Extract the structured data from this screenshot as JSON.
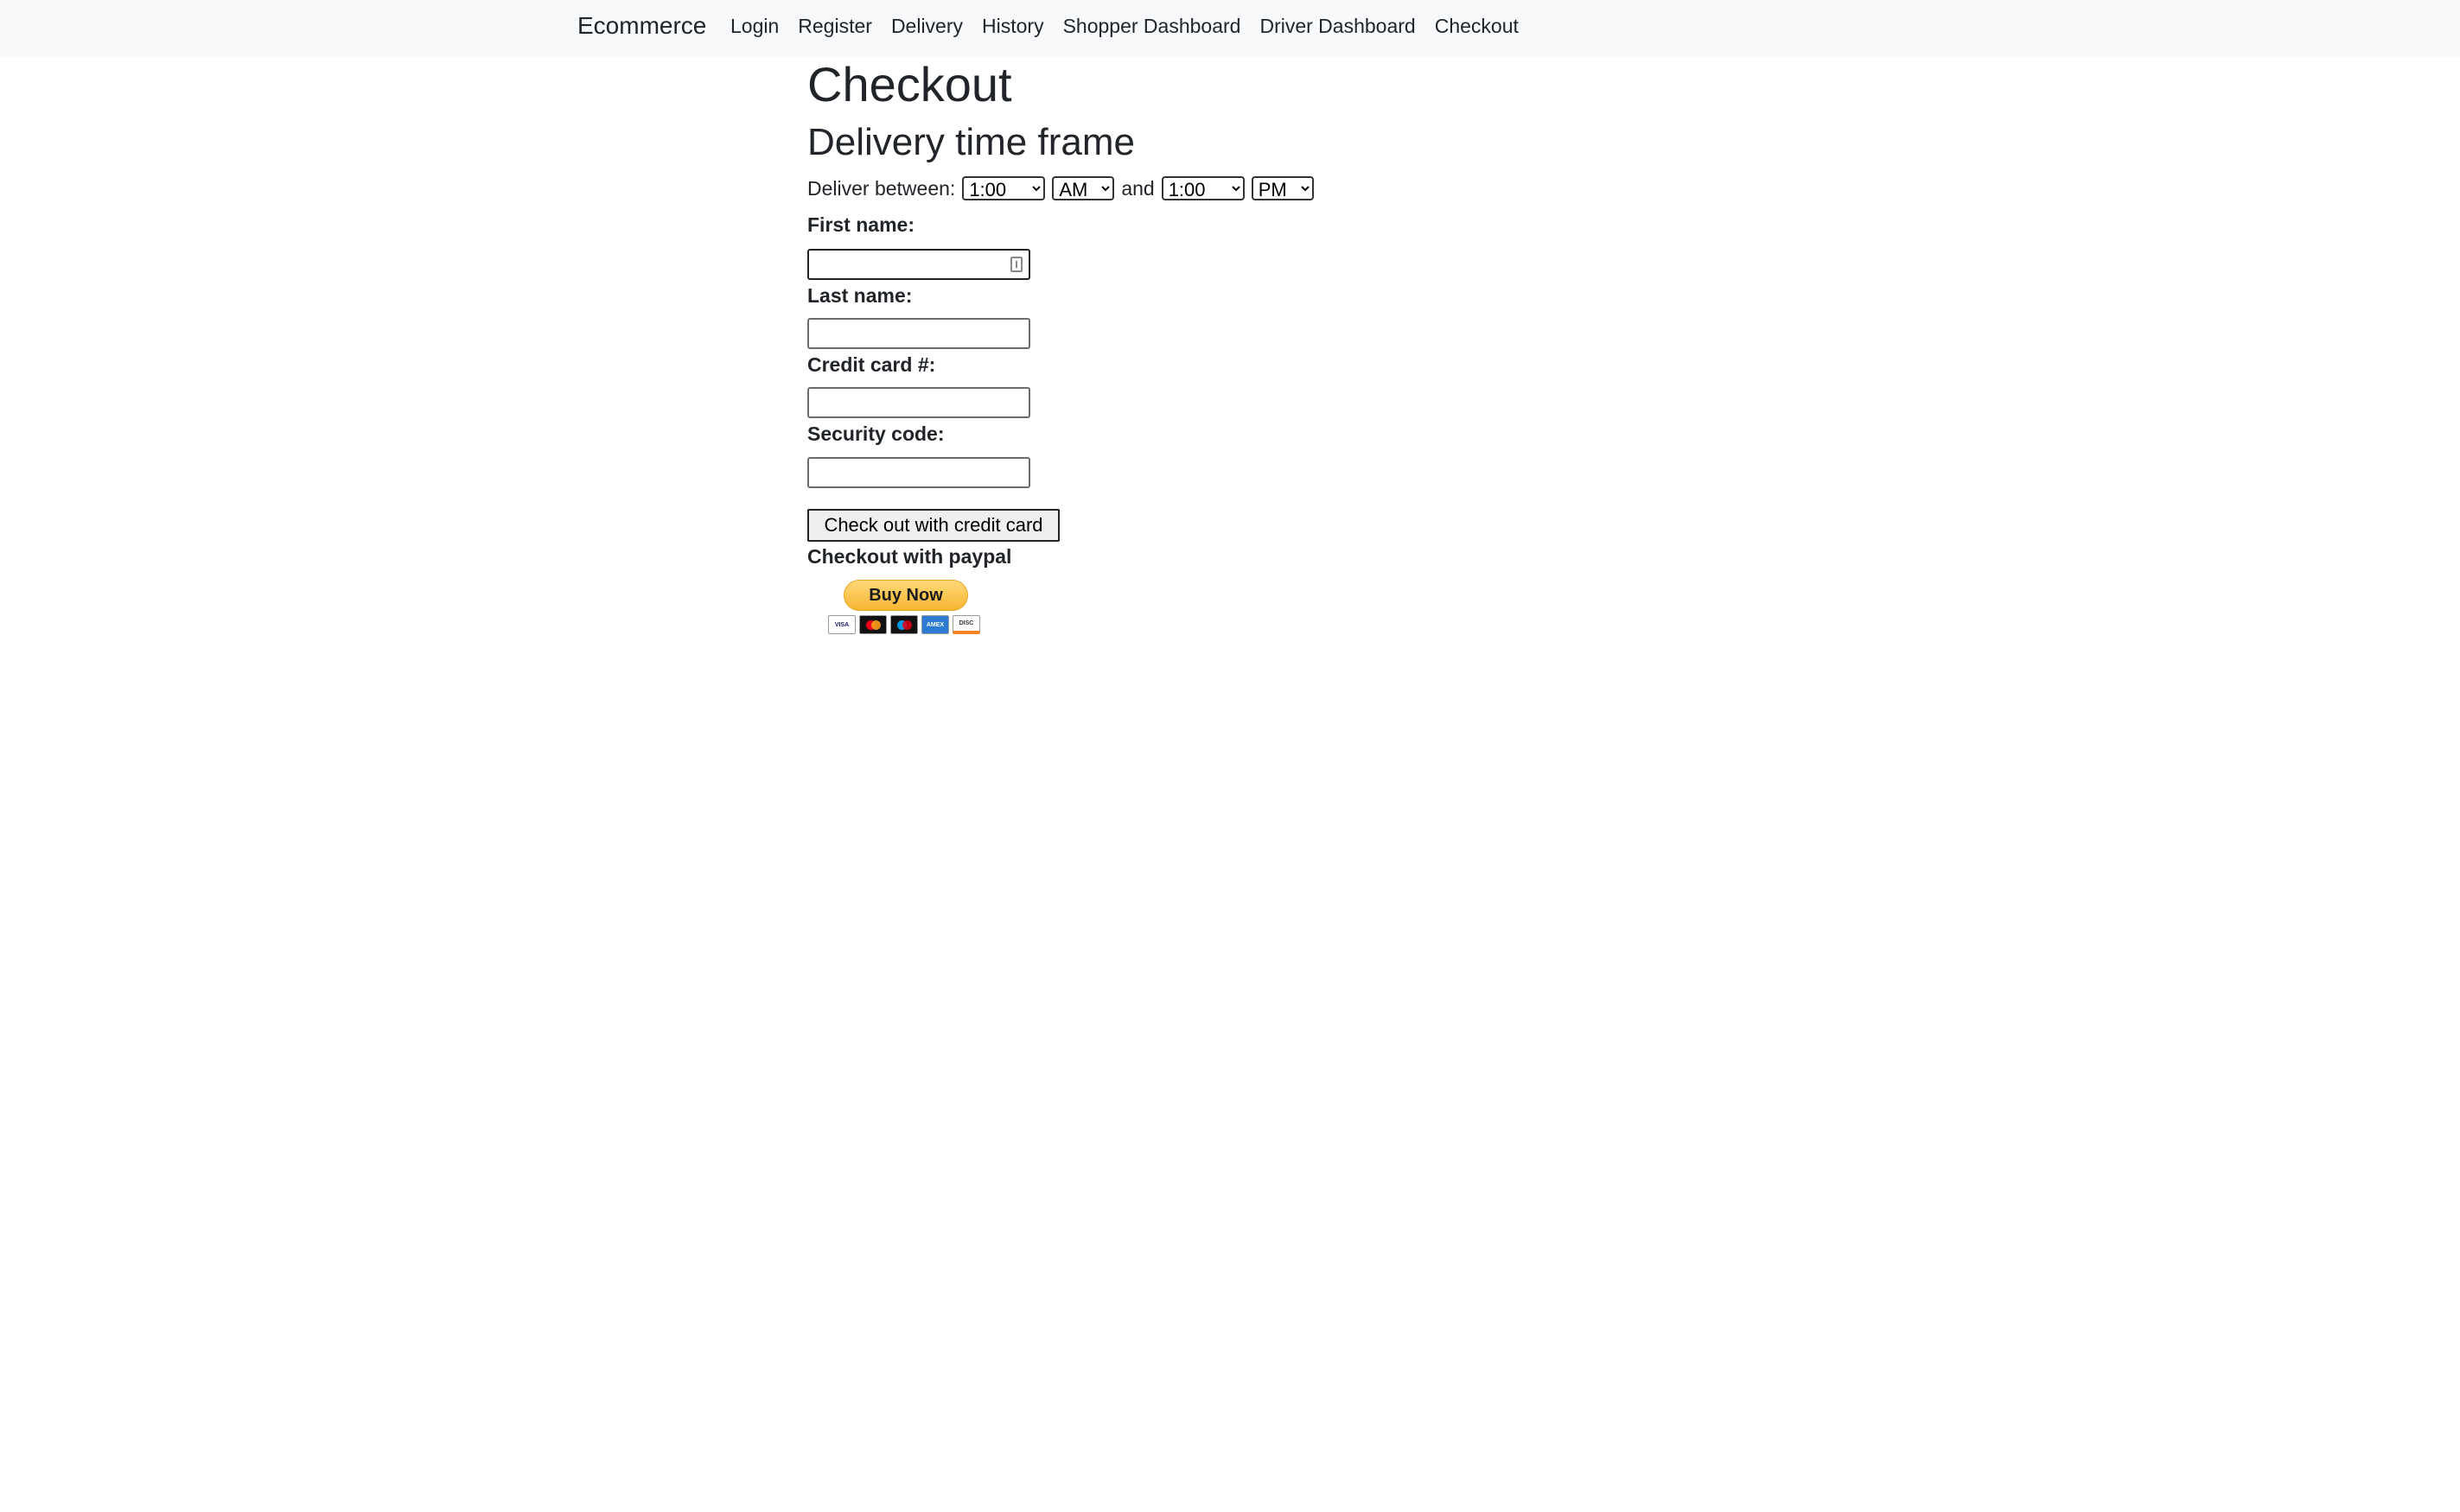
{
  "navbar": {
    "brand": "Ecommerce",
    "links": [
      "Login",
      "Register",
      "Delivery",
      "History",
      "Shopper Dashboard",
      "Driver Dashboard",
      "Checkout"
    ]
  },
  "page": {
    "title": "Checkout",
    "subtitle": "Delivery time frame"
  },
  "delivery": {
    "label": "Deliver between:",
    "from_time": "1:00",
    "from_ampm": "AM",
    "and_label": "and",
    "to_time": "1:00",
    "to_ampm": "PM"
  },
  "form": {
    "first_name_label": "First name:",
    "last_name_label": "Last name:",
    "credit_card_label": "Credit card #:",
    "security_code_label": "Security code:",
    "first_name_value": "",
    "last_name_value": "",
    "credit_card_value": "",
    "security_code_value": "",
    "submit_label": "Check out with credit card"
  },
  "paypal": {
    "heading": "Checkout with paypal",
    "button_label": "Buy Now",
    "card_logos": [
      "visa-icon",
      "mastercard-icon",
      "maestro-icon",
      "amex-icon",
      "discover-icon"
    ]
  }
}
